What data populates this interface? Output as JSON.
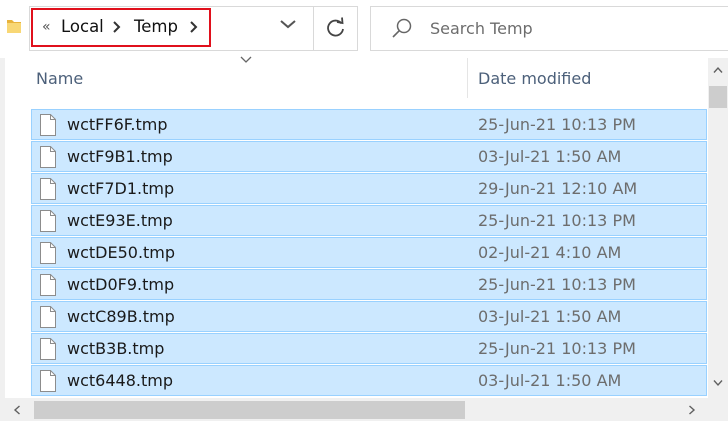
{
  "breadcrumb": {
    "overflow_glyph": "«",
    "items": [
      "Local",
      "Temp"
    ],
    "highlight_color": "#e0101c"
  },
  "search": {
    "placeholder": "Search Temp"
  },
  "columns": {
    "name": "Name",
    "date_modified": "Date modified"
  },
  "files": [
    {
      "name": "wctFF6F.tmp",
      "date": "25-Jun-21 10:13 PM"
    },
    {
      "name": "wctF9B1.tmp",
      "date": "03-Jul-21 1:50 AM"
    },
    {
      "name": "wctF7D1.tmp",
      "date": "29-Jun-21 12:10 AM"
    },
    {
      "name": "wctE93E.tmp",
      "date": "25-Jun-21 10:13 PM"
    },
    {
      "name": "wctDE50.tmp",
      "date": "02-Jul-21 4:10 AM"
    },
    {
      "name": "wctD0F9.tmp",
      "date": "25-Jun-21 10:13 PM"
    },
    {
      "name": "wctC89B.tmp",
      "date": "03-Jul-21 1:50 AM"
    },
    {
      "name": "wctB3B.tmp",
      "date": "25-Jun-21 10:13 PM"
    },
    {
      "name": "wct6448.tmp",
      "date": "03-Jul-21 1:50 AM"
    }
  ],
  "icons": {
    "folder": "folder-icon",
    "breadcrumb_separator": "chevron-right-icon",
    "address_dropdown": "chevron-down-icon",
    "refresh": "refresh-icon",
    "search": "search-icon",
    "sort": "sort-descending-icon",
    "file": "file-icon"
  },
  "colors": {
    "selection_fill": "#cce8ff",
    "selection_border": "#99d1ff",
    "header_text": "#4c607a"
  }
}
